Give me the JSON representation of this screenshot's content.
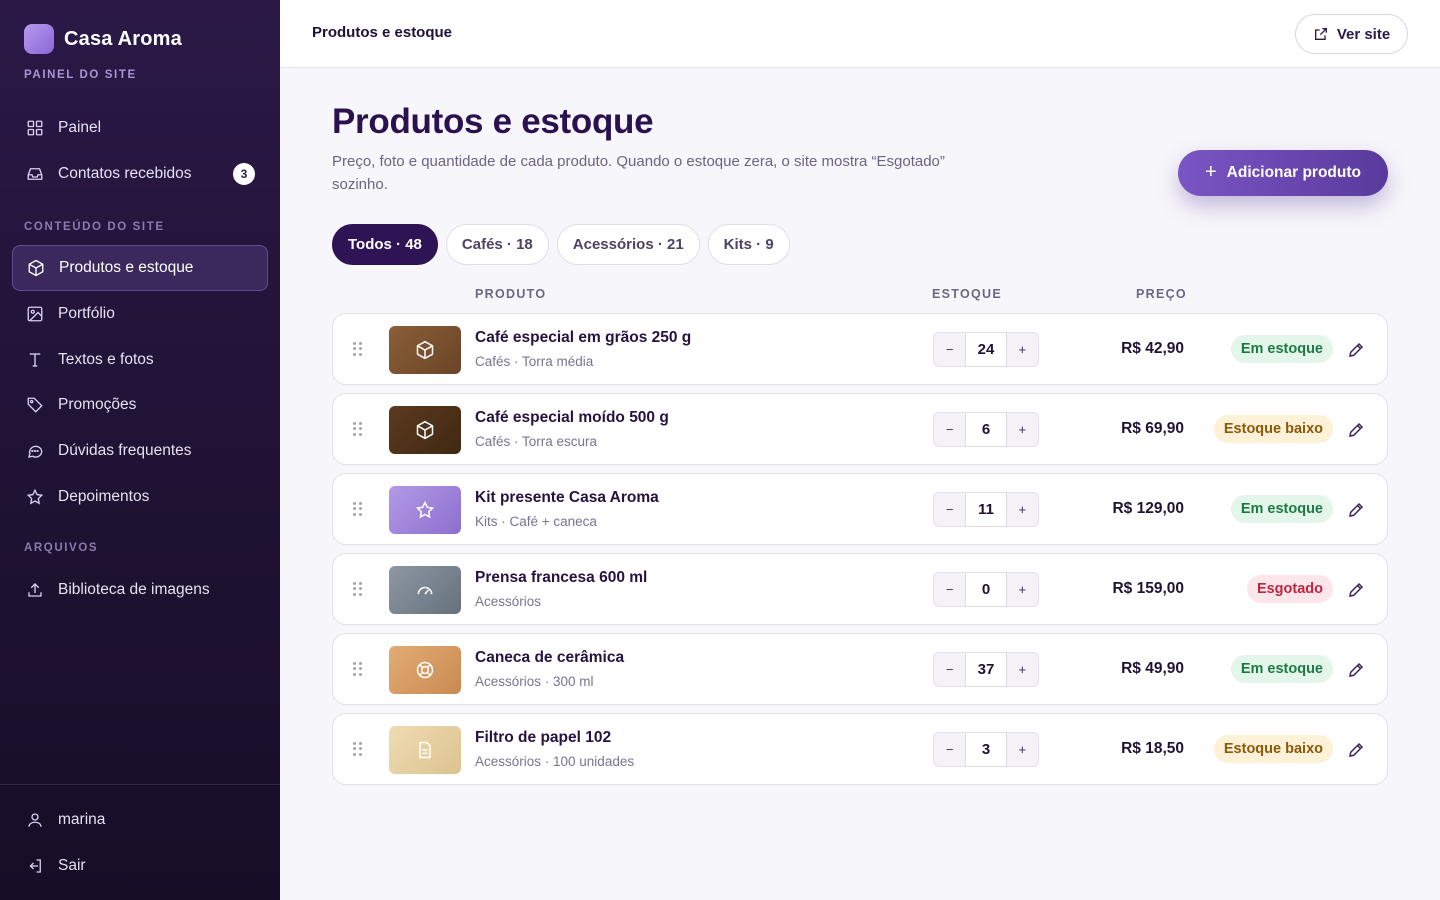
{
  "brand": {
    "name": "Casa Aroma",
    "subtitle": "PAINEL DO SITE"
  },
  "sidebar": {
    "items_top": [
      {
        "label": "Painel",
        "icon": "grid-icon"
      },
      {
        "label": "Contatos recebidos",
        "icon": "inbox-icon",
        "badge": "3"
      }
    ],
    "section_content": "CONTEÚDO DO SITE",
    "items_content": [
      {
        "label": "Produtos e estoque",
        "icon": "box-icon",
        "active": true
      },
      {
        "label": "Portfólio",
        "icon": "image-icon"
      },
      {
        "label": "Textos e fotos",
        "icon": "text-icon"
      },
      {
        "label": "Promoções",
        "icon": "tag-icon"
      },
      {
        "label": "Dúvidas frequentes",
        "icon": "chat-icon"
      },
      {
        "label": "Depoimentos",
        "icon": "star-icon"
      }
    ],
    "section_files": "ARQUIVOS",
    "items_files": [
      {
        "label": "Biblioteca de imagens",
        "icon": "upload-icon"
      }
    ],
    "user": {
      "label": "marina",
      "icon": "user-icon"
    },
    "logout": {
      "label": "Sair",
      "icon": "logout-icon"
    }
  },
  "topbar": {
    "title": "Produtos e estoque",
    "view_site": "Ver site"
  },
  "main": {
    "title": "Produtos e estoque",
    "description": "Preço, foto e quantidade de cada produto. Quando o estoque zera, o site mostra “Esgotado” sozinho.",
    "add_button": "Adicionar produto",
    "filters": [
      {
        "label": "Todos · 48",
        "active": true
      },
      {
        "label": "Cafés · 18"
      },
      {
        "label": "Acessórios · 21"
      },
      {
        "label": "Kits · 9"
      }
    ],
    "columns": {
      "product": "PRODUTO",
      "stock": "ESTOQUE",
      "price": "PREÇO"
    },
    "products": [
      {
        "name": "Café especial em grãos 250 g",
        "sub": "Cafés · Torra média",
        "stock": "24",
        "price": "R$ 42,90",
        "status": "Em estoque",
        "status_kind": "ok",
        "thumb_icon": "box-icon",
        "thumb_color": "#7a5230"
      },
      {
        "name": "Café especial moído 500 g",
        "sub": "Cafés · Torra escura",
        "stock": "6",
        "price": "R$ 69,90",
        "status": "Estoque baixo",
        "status_kind": "low",
        "thumb_icon": "box-icon",
        "thumb_color": "#4e3119"
      },
      {
        "name": "Kit presente Casa Aroma",
        "sub": "Kits · Café + caneca",
        "stock": "11",
        "price": "R$ 129,00",
        "status": "Em estoque",
        "status_kind": "ok",
        "thumb_icon": "star-icon",
        "thumb_color": "#9a7ed6"
      },
      {
        "name": "Prensa francesa 600 ml",
        "sub": "Acessórios",
        "stock": "0",
        "price": "R$ 159,00",
        "status": "Esgotado",
        "status_kind": "out",
        "thumb_icon": "gauge-icon",
        "thumb_color": "#78838f"
      },
      {
        "name": "Caneca de cerâmica",
        "sub": "Acessórios · 300 ml",
        "stock": "37",
        "price": "R$ 49,90",
        "status": "Em estoque",
        "status_kind": "ok",
        "thumb_icon": "lifebuoy-icon",
        "thumb_color": "#d59a62"
      },
      {
        "name": "Filtro de papel 102",
        "sub": "Acessórios · 100 unidades",
        "stock": "3",
        "price": "R$ 18,50",
        "status": "Estoque baixo",
        "status_kind": "low",
        "thumb_icon": "document-icon",
        "thumb_color": "#e5cfa2"
      }
    ]
  },
  "colors": {
    "accent": "#6b47b3",
    "sidebar_bg": "#21133a",
    "active_chip": "#2e1454"
  }
}
